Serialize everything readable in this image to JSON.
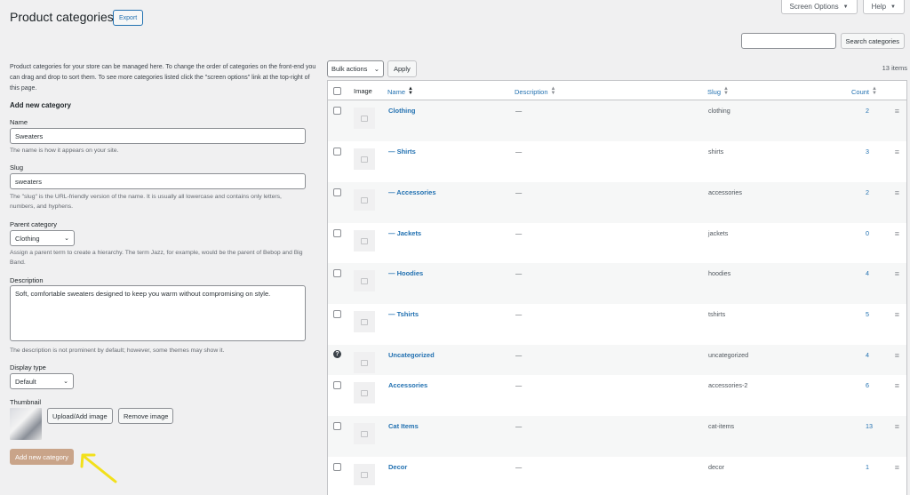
{
  "header": {
    "title": "Product categories",
    "export_label": "Export",
    "screen_options_label": "Screen Options",
    "help_label": "Help",
    "search_button_label": "Search categories",
    "search_value": ""
  },
  "form": {
    "intro": "Product categories for your store can be managed here. To change the order of categories on the front-end you can drag and drop to sort them. To see more categories listed click the \"screen options\" link at the top-right of this page.",
    "heading": "Add new category",
    "name_label": "Name",
    "name_value": "Sweaters",
    "name_help": "The name is how it appears on your site.",
    "slug_label": "Slug",
    "slug_value": "sweaters",
    "slug_help": "The \"slug\" is the URL-friendly version of the name. It is usually all lowercase and contains only letters, numbers, and hyphens.",
    "parent_label": "Parent category",
    "parent_value": "Clothing",
    "parent_help": "Assign a parent term to create a hierarchy. The term Jazz, for example, would be the parent of Bebop and Big Band.",
    "description_label": "Description",
    "description_value": "Soft, comfortable sweaters designed to keep you warm without compromising on style.",
    "description_help": "The description is not prominent by default; however, some themes may show it.",
    "display_type_label": "Display type",
    "display_type_value": "Default",
    "thumbnail_label": "Thumbnail",
    "upload_label": "Upload/Add image",
    "remove_label": "Remove image",
    "submit_label": "Add new category"
  },
  "table": {
    "bulk_actions_label": "Bulk actions",
    "apply_label": "Apply",
    "items_count": "13 items",
    "columns": {
      "image": "Image",
      "name": "Name",
      "description": "Description",
      "slug": "Slug",
      "count": "Count"
    },
    "rows": [
      {
        "name": "Clothing",
        "description": "—",
        "slug": "clothing",
        "count": "2"
      },
      {
        "name": "— Shirts",
        "description": "—",
        "slug": "shirts",
        "count": "3"
      },
      {
        "name": "— Accessories",
        "description": "—",
        "slug": "accessories",
        "count": "2"
      },
      {
        "name": "— Jackets",
        "description": "—",
        "slug": "jackets",
        "count": "0"
      },
      {
        "name": "— Hoodies",
        "description": "—",
        "slug": "hoodies",
        "count": "4"
      },
      {
        "name": "— Tshirts",
        "description": "—",
        "slug": "tshirts",
        "count": "5"
      },
      {
        "name": "Uncategorized",
        "description": "—",
        "slug": "uncategorized",
        "count": "4"
      },
      {
        "name": "Accessories",
        "description": "—",
        "slug": "accessories-2",
        "count": "6"
      },
      {
        "name": "Cat Items",
        "description": "—",
        "slug": "cat-items",
        "count": "13"
      },
      {
        "name": "Decor",
        "description": "—",
        "slug": "decor",
        "count": "1"
      }
    ]
  },
  "colors": {
    "accent": "#2271b1",
    "primary_button": "#c9a489",
    "annotation_arrow": "#f2e01b"
  }
}
